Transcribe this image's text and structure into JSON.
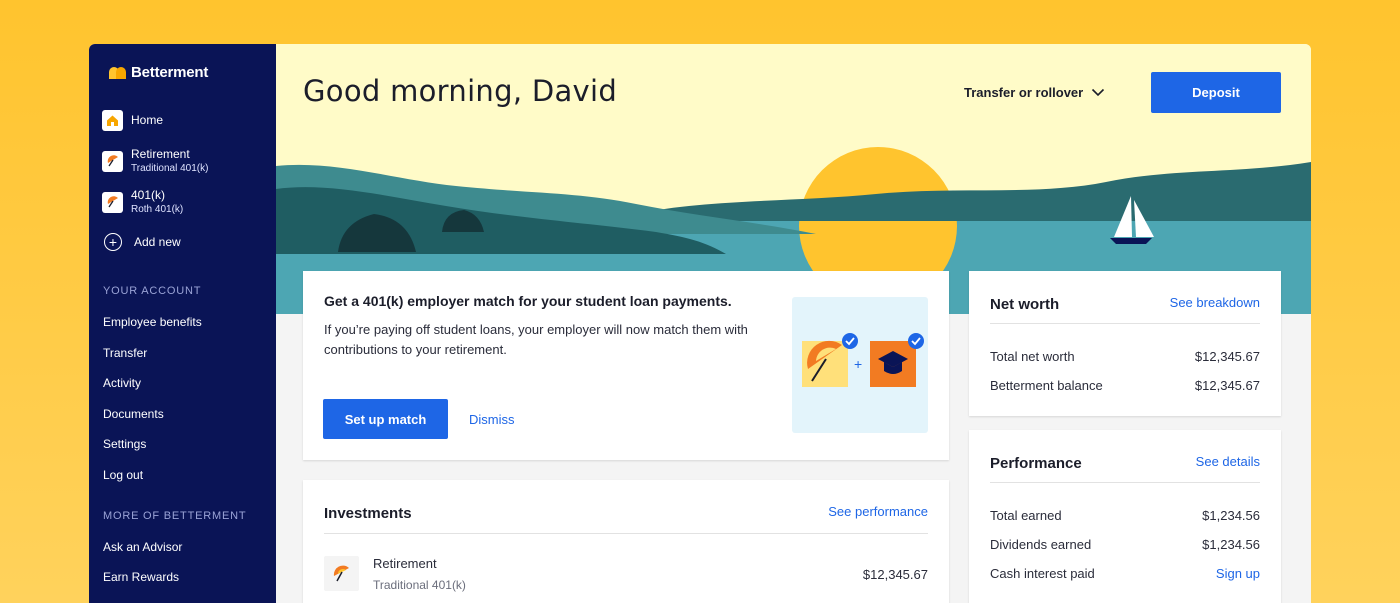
{
  "brand": {
    "name": "Betterment"
  },
  "sidebar": {
    "home": {
      "label": "Home",
      "icon": "house-icon"
    },
    "accounts": [
      {
        "title": "Retirement",
        "subtitle": "Traditional 401(k)",
        "icon": "umbrella-icon"
      },
      {
        "title": "401(k)",
        "subtitle": "Roth 401(k)",
        "icon": "umbrella-icon"
      }
    ],
    "add_new": "Add new",
    "section_account": "YOUR ACCOUNT",
    "account_links": [
      "Employee benefits",
      "Transfer",
      "Activity",
      "Documents",
      "Settings",
      "Log out"
    ],
    "section_more": "MORE OF BETTERMENT",
    "more_links": [
      "Ask an Advisor",
      "Earn Rewards"
    ]
  },
  "header": {
    "greeting": "Good morning, David",
    "transfer_label": "Transfer or rollover",
    "deposit_label": "Deposit"
  },
  "promo": {
    "title": "Get a 401(k) employer match for your student loan payments.",
    "body": "If you’re paying off student loans, your employer will now match them with contributions to your retirement.",
    "primary_label": "Set up match",
    "dismiss_label": "Dismiss"
  },
  "investments": {
    "title": "Investments",
    "link": "See performance",
    "rows": [
      {
        "title": "Retirement",
        "subtitle": "Traditional 401(k)",
        "value": "$12,345.67"
      }
    ]
  },
  "net_worth": {
    "title": "Net worth",
    "link": "See breakdown",
    "rows": [
      {
        "label": "Total net worth",
        "value": "$12,345.67"
      },
      {
        "label": "Betterment balance",
        "value": "$12,345.67"
      }
    ]
  },
  "performance": {
    "title": "Performance",
    "link": "See details",
    "rows": [
      {
        "label": "Total earned",
        "value": "$1,234.56"
      },
      {
        "label": "Dividends earned",
        "value": "$1,234.56"
      },
      {
        "label": "Cash interest paid",
        "value": "Sign up"
      }
    ]
  },
  "colors": {
    "sidebar": "#0A1456",
    "accent": "#1E66E6",
    "hero_sky": "#FFFBC8",
    "sun": "#FFC42E",
    "outer_background": "#FFC42E"
  }
}
